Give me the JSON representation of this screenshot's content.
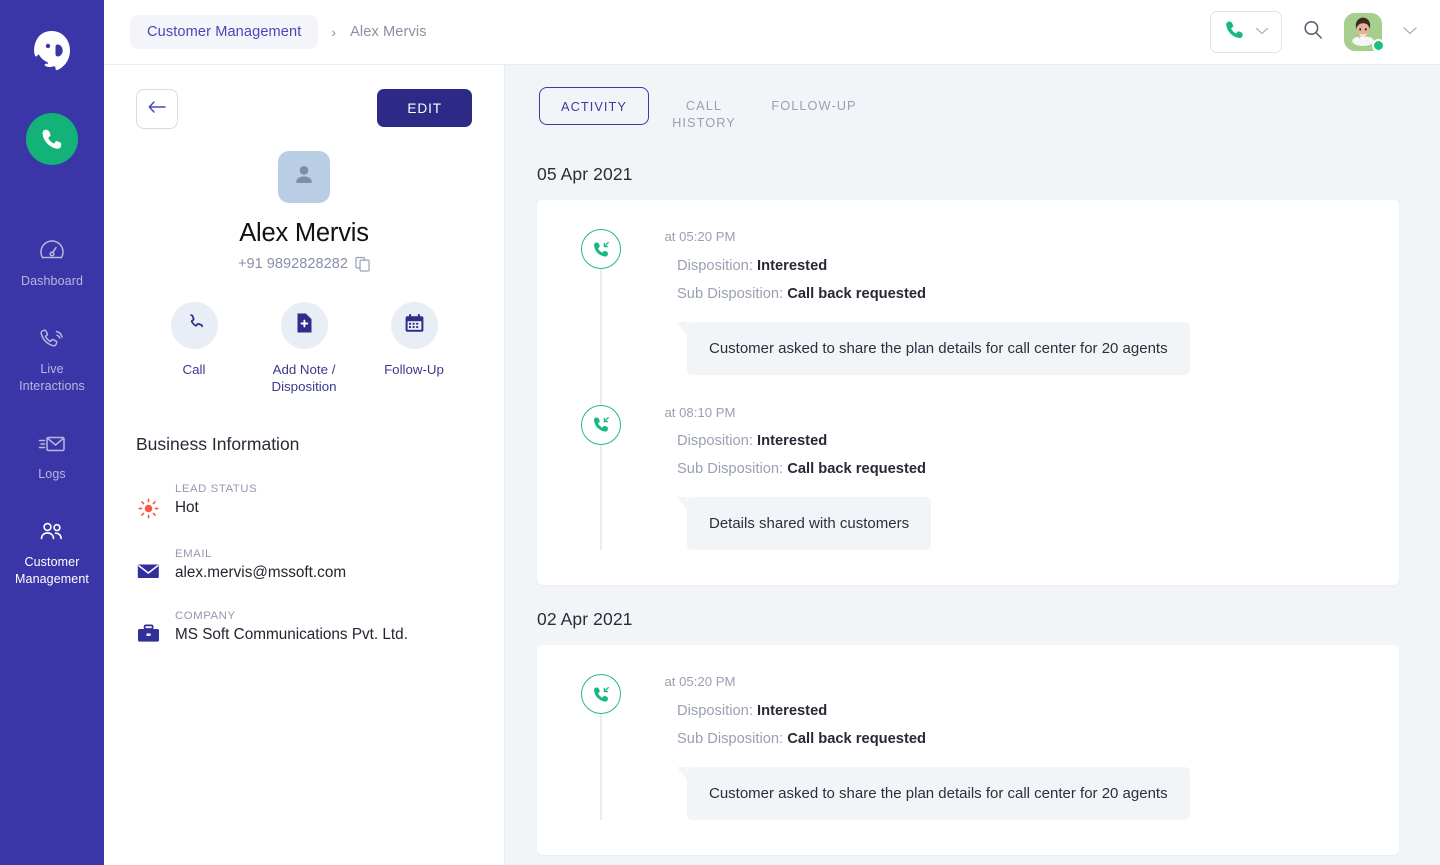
{
  "sidebar": {
    "logo_icon": "headset-agent-logo",
    "call_button_icon": "phone-icon",
    "items": [
      {
        "label": "Dashboard",
        "icon": "speedometer-icon",
        "active": false
      },
      {
        "label": "Live Interactions",
        "icon": "phone-signal-icon",
        "active": false
      },
      {
        "label": "Logs",
        "icon": "envelope-send-icon",
        "active": false
      },
      {
        "label": "Customer Management",
        "icon": "users-icon",
        "active": true
      }
    ]
  },
  "header": {
    "breadcrumb_root": "Customer Management",
    "breadcrumb_separator": "›",
    "breadcrumb_current": "Alex Mervis",
    "dialer_icon": "phone-icon",
    "dialer_caret_icon": "chevron-down-icon",
    "search_icon": "search-icon",
    "avatar_icon": "user-avatar",
    "avatar_caret_icon": "chevron-down-icon",
    "status_color": "#19c37d"
  },
  "detail": {
    "back_icon": "arrow-left-icon",
    "edit_label": "EDIT",
    "avatar_icon": "person-placeholder-icon",
    "name": "Alex Mervis",
    "phone": "+91 9892828282",
    "copy_icon": "copy-icon",
    "actions": [
      {
        "label": "Call",
        "icon": "phone-icon"
      },
      {
        "label": "Add Note / Disposition",
        "icon": "note-add-icon"
      },
      {
        "label": "Follow-Up",
        "icon": "calendar-icon"
      }
    ],
    "business_title": "Business Information",
    "fields": [
      {
        "key": "LEAD STATUS",
        "value": "Hot",
        "icon": "sun-icon",
        "icon_color": "#f9553f"
      },
      {
        "key": "EMAIL",
        "value": "alex.mervis@mssoft.com",
        "icon": "envelope-icon",
        "icon_color": "#31309b"
      },
      {
        "key": "COMPANY",
        "value": "MS Soft Communications Pvt. Ltd.",
        "icon": "briefcase-icon",
        "icon_color": "#31309b"
      }
    ]
  },
  "activity": {
    "tabs": [
      {
        "label": "ACTIVITY",
        "active": true
      },
      {
        "label": "CALL HISTORY",
        "active": false
      },
      {
        "label": "FOLLOW-UP",
        "active": false
      }
    ],
    "labels": {
      "disposition": "Disposition:",
      "sub_disposition": "Sub Disposition:"
    },
    "groups": [
      {
        "date": "05 Apr 2021",
        "entries": [
          {
            "time": "at 05:20 PM",
            "call_icon": "incoming-call-icon",
            "disposition": "Interested",
            "sub_disposition": "Call back requested",
            "note": "Customer asked to share the plan details for call center for 20 agents"
          },
          {
            "time": "at 08:10 PM",
            "call_icon": "incoming-call-icon",
            "disposition": "Interested",
            "sub_disposition": "Call back requested",
            "note": "Details shared with customers"
          }
        ]
      },
      {
        "date": "02 Apr 2021",
        "entries": [
          {
            "time": "at 05:20 PM",
            "call_icon": "incoming-call-icon",
            "disposition": "Interested",
            "sub_disposition": "Call back requested",
            "note": "Customer asked to share the plan details for call center for 20 agents"
          }
        ]
      }
    ]
  },
  "colors": {
    "rail": "#3a36a8",
    "accent": "#2c2a86",
    "green": "#12b279",
    "timeline_green": "#23b98a",
    "panel_bg": "#f2f5f8"
  }
}
